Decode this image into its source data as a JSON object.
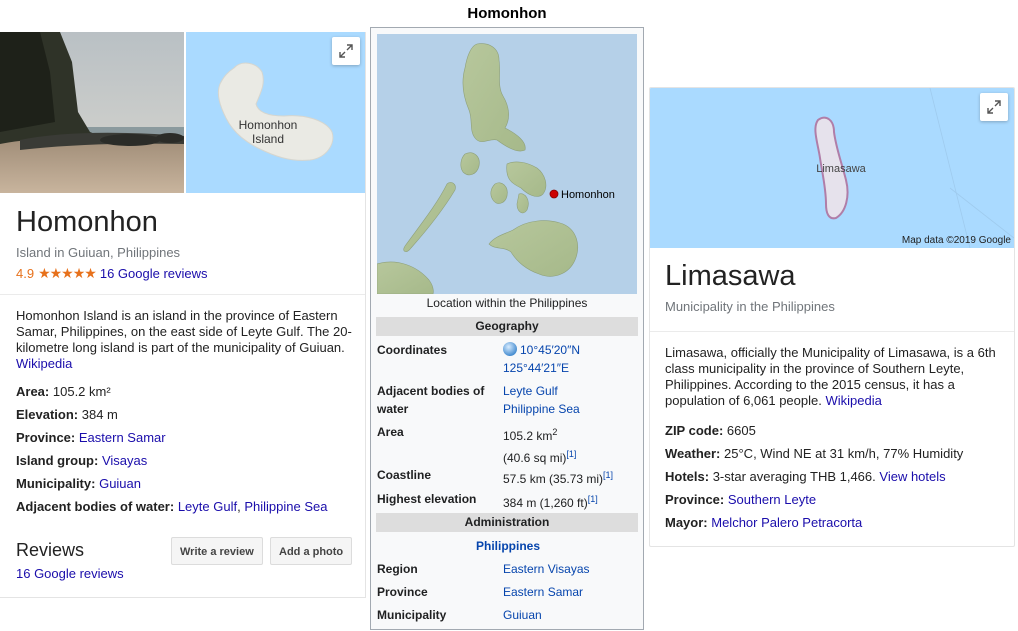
{
  "left": {
    "title": "Homonhon",
    "subtitle": "Island in Guiuan, Philippines",
    "rating": "4.9",
    "stars": "★★★★★",
    "reviews_link": "16 Google reviews",
    "map_label_line1": "Homonhon",
    "map_label_line2": "Island",
    "desc": "Homonhon Island is an island in the province of Eastern Samar, Philippines, on the east side of Leyte Gulf. The 20-kilometre long island is part of the municipality of Guiuan.",
    "desc_source": "Wikipedia",
    "facts": {
      "area_label": "Area:",
      "area_value": "105.2 km²",
      "elev_label": "Elevation:",
      "elev_value": "384 m",
      "province_label": "Province:",
      "province_value": "Eastern Samar",
      "group_label": "Island group:",
      "group_value": "Visayas",
      "muni_label": "Municipality:",
      "muni_value": "Guiuan",
      "water_label": "Adjacent bodies of water:",
      "water_value1": "Leyte Gulf",
      "water_sep": ", ",
      "water_value2": "Philippine Sea"
    },
    "reviews_heading": "Reviews",
    "reviews_count": "16 Google reviews",
    "write_review": "Write a review",
    "add_photo": "Add a photo"
  },
  "middle": {
    "title": "Homonhon",
    "map_marker_label": "Homonhon",
    "caption": "Location within the Philippines",
    "geography_header": "Geography",
    "coords_label": "Coordinates",
    "coords_line1": "10°45′20″N",
    "coords_line2": "125°44′21″E",
    "adj_label_1": "Adjacent bodies of",
    "adj_label_2": "water",
    "adj_value1": "Leyte Gulf",
    "adj_value2": "Philippine Sea",
    "area_label": "Area",
    "area_value": "105.2 km",
    "area_sup": "2",
    "area_value2": "(40.6 sq mi)",
    "area_ref": "[1]",
    "coast_label": "Coastline",
    "coast_value": "57.5 km (35.73 mi)",
    "coast_ref": "[1]",
    "elev_label": "Highest elevation",
    "elev_value": "384 m (1,260 ft)",
    "elev_ref": "[1]",
    "admin_header": "Administration",
    "country": "Philippines",
    "region_label": "Region",
    "region_value": "Eastern Visayas",
    "province_label": "Province",
    "province_value": "Eastern Samar",
    "muni_label": "Municipality",
    "muni_value": "Guiuan"
  },
  "right": {
    "map_label": "Limasawa",
    "map_data": "Map data ©2019 Google",
    "title": "Limasawa",
    "subtitle": "Municipality in the Philippines",
    "desc": "Limasawa, officially the Municipality of Limasawa, is a 6th class municipality in the province of Southern Leyte, Philippines. According to the 2015 census, it has a population of 6,061 people.",
    "desc_source": "Wikipedia",
    "facts": {
      "zip_label": "ZIP code:",
      "zip_value": "6605",
      "weather_label": "Weather:",
      "weather_value": "25°C, Wind NE at 31 km/h, 77% Humidity",
      "hotels_label": "Hotels:",
      "hotels_value": "3-star averaging THB 1,466.",
      "hotels_link": "View hotels",
      "province_label": "Province:",
      "province_value": "Southern Leyte",
      "mayor_label": "Mayor:",
      "mayor_value": "Melchor Palero Petracorta"
    }
  },
  "colors": {
    "link": "#1a0dab",
    "wiki_link": "#0645ad",
    "star": "#e7711b",
    "map_water": "#aadaff"
  }
}
